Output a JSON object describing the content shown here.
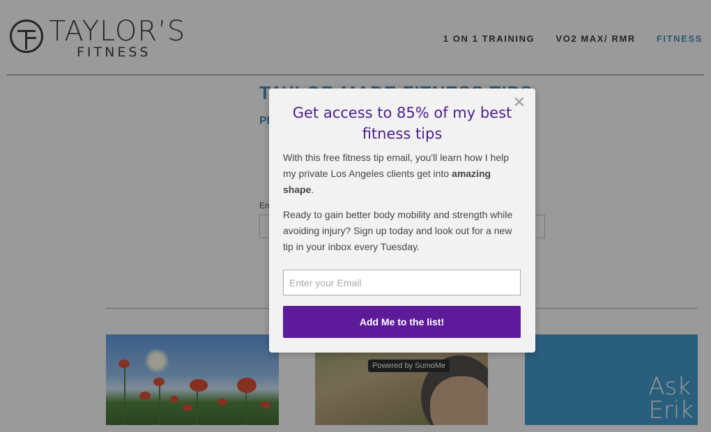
{
  "header": {
    "logo": {
      "name": "TAYLOR’S",
      "subtitle": "FITNESS"
    },
    "nav": [
      {
        "label": "1 ON 1 TRAINING",
        "active": false
      },
      {
        "label": "VO2 MAX/ RMR",
        "active": false
      },
      {
        "label": "FITNESS",
        "active": true
      }
    ],
    "accent_color": "#2b7fb4"
  },
  "background": {
    "section_title": "TAYLOR MADE FITNESS TIPS",
    "section_subtitle": "PL",
    "email_label": "Em",
    "thumbnails": [
      {
        "name": "poppy-field-image"
      },
      {
        "name": "trail-portrait-image",
        "badge": "Powered by SumoMe"
      },
      {
        "name": "ask-erik-tile",
        "lines": [
          "Ask",
          "Erik"
        ]
      }
    ]
  },
  "modal": {
    "close_icon": "close-icon",
    "title": "Get access to 85% of my best fitness tips",
    "paragraph1_start": "With this free fitness tip email, you'll learn how I help my private Los Angeles clients get into ",
    "paragraph1_bold": "amazing shape",
    "paragraph1_end": ".",
    "paragraph2": "Ready to gain better body mobility and strength while avoiding injury? Sign up today and look out for a new tip in your inbox every Tuesday.",
    "email_placeholder": "Enter your Email",
    "submit_label": "Add Me to the list!",
    "title_color": "#4b1d8c",
    "button_color": "#5d1b9b"
  }
}
